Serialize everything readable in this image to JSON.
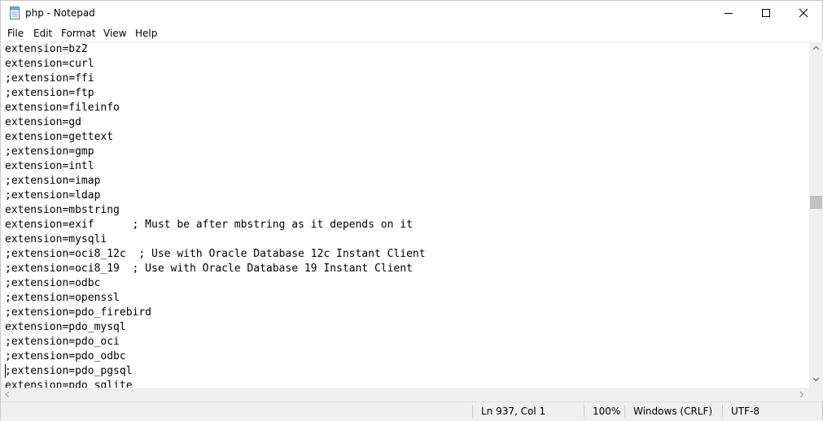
{
  "window": {
    "title": "php - Notepad"
  },
  "menu": {
    "file": "File",
    "edit": "Edit",
    "format": "Format",
    "view": "View",
    "help": "Help"
  },
  "editor": {
    "lines": [
      "extension=bz2",
      "extension=curl",
      ";extension=ffi",
      ";extension=ftp",
      "extension=fileinfo",
      "extension=gd",
      "extension=gettext",
      ";extension=gmp",
      "extension=intl",
      ";extension=imap",
      ";extension=ldap",
      "extension=mbstring",
      "extension=exif      ; Must be after mbstring as it depends on it",
      "extension=mysqli",
      ";extension=oci8_12c  ; Use with Oracle Database 12c Instant Client",
      ";extension=oci8_19  ; Use with Oracle Database 19 Instant Client",
      ";extension=odbc",
      ";extension=openssl",
      ";extension=pdo_firebird",
      "extension=pdo_mysql",
      ";extension=pdo_oci",
      ";extension=pdo_odbc",
      ";extension=pdo_pgsql",
      "extension=pdo_sqlite"
    ],
    "scroll_position_fraction": 0.45
  },
  "status": {
    "position": "Ln 937, Col 1",
    "zoom": "100%",
    "line_ending": "Windows (CRLF)",
    "encoding": "UTF-8"
  }
}
